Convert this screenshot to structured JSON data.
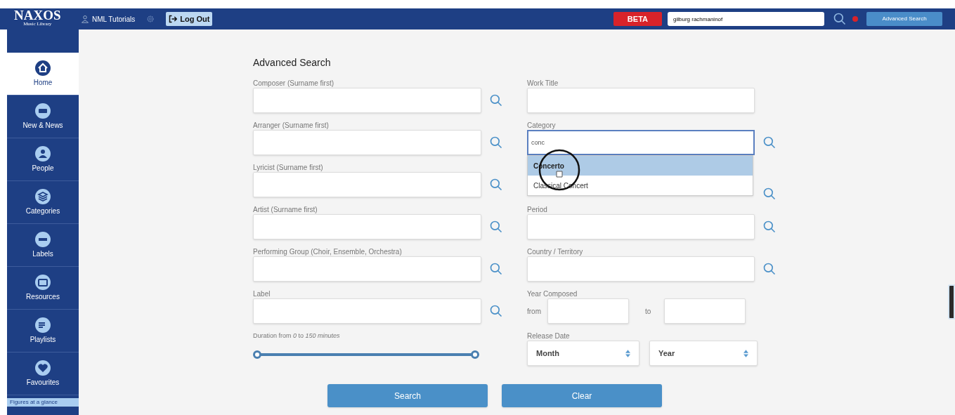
{
  "header": {
    "logo": {
      "title": "NAXOS",
      "subtitle": "Music Library"
    },
    "user_link": "NML Tutorials",
    "logout": "Log Out",
    "beta": "BETA",
    "search": {
      "value": "gilburg rachmaninof"
    },
    "advanced_search": "Advanced Search"
  },
  "sidebar": {
    "items": [
      {
        "label": "Home",
        "selected": true
      },
      {
        "label": "New & News",
        "selected": false
      },
      {
        "label": "People",
        "selected": false
      },
      {
        "label": "Categories",
        "selected": false
      },
      {
        "label": "Labels",
        "selected": false
      },
      {
        "label": "Resources",
        "selected": false
      },
      {
        "label": "Playlists",
        "selected": false
      },
      {
        "label": "Favourites",
        "selected": false
      }
    ],
    "footer": "Figures at a glance"
  },
  "form": {
    "title": "Advanced Search",
    "left_fields": [
      {
        "label": "Composer (Surname first)"
      },
      {
        "label": "Arranger (Surname first)"
      },
      {
        "label": "Lyricist (Surname first)"
      },
      {
        "label": "Artist (Surname first)"
      },
      {
        "label": "Performing Group (Choir, Ensemble, Orchestra)"
      },
      {
        "label": "Label"
      }
    ],
    "duration": {
      "label": "Duration from *0* to *150* *minutes*",
      "thumbs": [
        {
          "level": 0
        },
        {
          "level": 1
        }
      ]
    },
    "work_title": {
      "label": "Work Title"
    },
    "category": {
      "label": "Category",
      "value": "conc",
      "suggestions": [
        {
          "label": "Concerto",
          "selected": true
        },
        {
          "label": "Classical Concert",
          "selected": false
        }
      ]
    },
    "right_fields": [
      {
        "label": "Period"
      },
      {
        "label": "Country / Territory"
      }
    ],
    "year_composed": {
      "label": "Year Composed",
      "from": "from",
      "to": "to"
    },
    "release_date": {
      "label": "Release Date",
      "month": "Month",
      "year": "Year"
    },
    "buttons": [
      "Search",
      "Clear"
    ]
  }
}
